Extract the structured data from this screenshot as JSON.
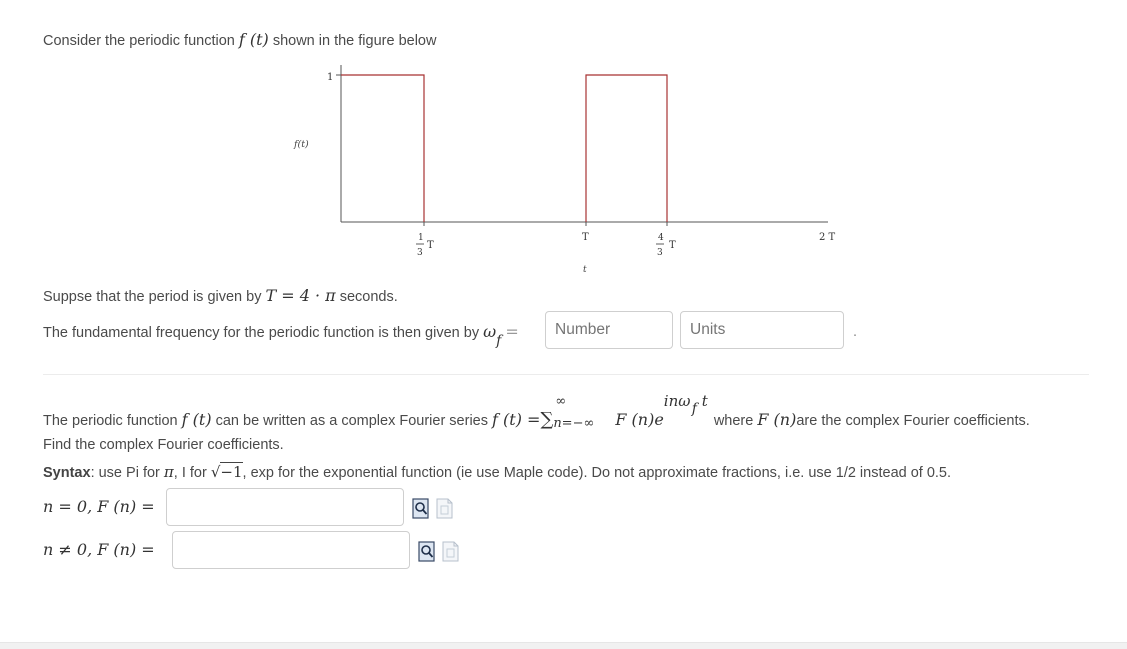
{
  "intro": {
    "prefix": "Consider the periodic function",
    "func": "f (t)",
    "suffix": "shown in the figure below"
  },
  "figure": {
    "ylabel": "f(t)",
    "xlabel": "t",
    "y_tick": "1",
    "x_ticks": {
      "third": {
        "num": "1",
        "den": "3",
        "sym": "T"
      },
      "T": "T",
      "four_thirds": {
        "num": "4",
        "den": "3",
        "sym": "T"
      },
      "twoT": "2 T"
    },
    "pulses": [
      {
        "start": 0,
        "end": 0.3333,
        "value": 1
      },
      {
        "start": 1,
        "end": 1.3333,
        "value": 1
      }
    ],
    "line_color": "#a83232",
    "axis_color": "#555555"
  },
  "period": {
    "prefix": "Suppse that the period is given by",
    "eq": "T = 4 · π",
    "suffix": "seconds."
  },
  "fundamental": {
    "prefix": "The fundamental frequency for the periodic function is then given by",
    "omega": "ω",
    "sub": "f",
    "eq": "=",
    "number_placeholder": "Number",
    "units_placeholder": "Units",
    "trailing": "."
  },
  "series": {
    "prefix": "The periodic function",
    "func": "f (t)",
    "mid": "can be written as a complex Fourier series",
    "lhs": "f (t) =",
    "sum": "∑",
    "sum_top": "∞",
    "sum_bottom": "n=−∞",
    "Fn": "F (n)e",
    "exponent": "inω",
    "exp_sub": "f",
    "exp_t": "t",
    "where": "where",
    "Fn2": "F (n)",
    "tail": "are the complex Fourier coefficients."
  },
  "find": "Find the complex Fourier coefficients.",
  "syntax": {
    "bold": "Syntax",
    "t1": ": use Pi for",
    "pi": "π",
    "t2": ", I for",
    "sqrt": "−1",
    "t3": ", exp for the exponential function (ie use Maple code). Do not approximate fractions, i.e. use 1/2 instead of 0.5."
  },
  "answers": [
    {
      "label": "n = 0,  F (n) =",
      "value": ""
    },
    {
      "label": "n ≠ 0,   F (n) =",
      "value": ""
    }
  ]
}
